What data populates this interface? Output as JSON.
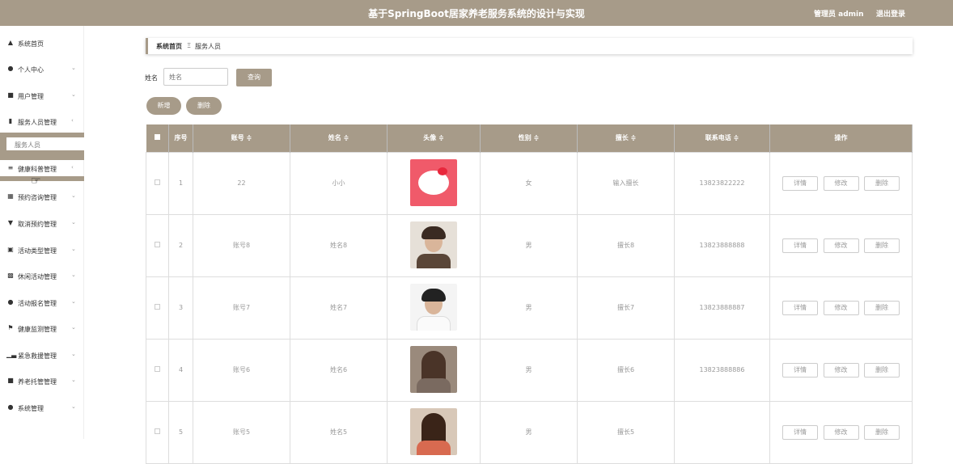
{
  "header": {
    "title": "基于SpringBoot居家养老服务系统的设计与实现",
    "admin_label": "管理员 admin",
    "logout_label": "退出登录"
  },
  "sidebar": {
    "items": [
      {
        "label": "系统首页",
        "icon": "home-icon"
      },
      {
        "label": "个人中心",
        "icon": "user-icon"
      },
      {
        "label": "用户管理",
        "icon": "grid-icon"
      },
      {
        "label": "服务人员管理",
        "icon": "id-card-icon"
      },
      {
        "label": "健康科普管理",
        "icon": "list-icon"
      },
      {
        "label": "预约咨询管理",
        "icon": "apps-icon"
      },
      {
        "label": "取消预约管理",
        "icon": "pin-icon"
      },
      {
        "label": "活动类型管理",
        "icon": "image-icon"
      },
      {
        "label": "休闲活动管理",
        "icon": "clipboard-icon"
      },
      {
        "label": "活动报名管理",
        "icon": "user-icon"
      },
      {
        "label": "健康监测管理",
        "icon": "flag-icon"
      },
      {
        "label": "紧急救援管理",
        "icon": "bar-chart-icon"
      },
      {
        "label": "养老托管管理",
        "icon": "grid-icon"
      },
      {
        "label": "系统管理",
        "icon": "user-icon"
      }
    ],
    "submenu_item": "服务人员"
  },
  "breadcrumb": {
    "home": "系统首页",
    "separator": "Ξ",
    "current": "服务人员"
  },
  "search": {
    "label": "姓名",
    "placeholder": "姓名",
    "query_button": "查询"
  },
  "actions": {
    "add_button": "新增",
    "delete_button": "删除"
  },
  "table": {
    "headers": [
      "序号",
      "账号 ≑",
      "姓名 ≑",
      "头像 ≑",
      "性别 ≑",
      "擅长 ≑",
      "联系电话 ≑",
      "操作"
    ],
    "rows": [
      {
        "index": "1",
        "account": "22",
        "name": "小小",
        "avatar": "hello-kitty",
        "gender": "女",
        "specialty": "输入擅长",
        "phone": "13823822222"
      },
      {
        "index": "2",
        "account": "账号8",
        "name": "姓名8",
        "avatar": "man-photo",
        "gender": "男",
        "specialty": "擅长8",
        "phone": "13823888888"
      },
      {
        "index": "3",
        "account": "账号7",
        "name": "姓名7",
        "avatar": "man-photo-2",
        "gender": "男",
        "specialty": "擅长7",
        "phone": "13823888887"
      },
      {
        "index": "4",
        "account": "账号6",
        "name": "姓名6",
        "avatar": "woman-photo",
        "gender": "男",
        "specialty": "擅长6",
        "phone": "13823888886"
      },
      {
        "index": "5",
        "account": "账号5",
        "name": "姓名5",
        "avatar": "woman-photo-2",
        "gender": "男",
        "specialty": "擅长5",
        "phone": ""
      }
    ],
    "row_actions": {
      "detail": "详情",
      "edit": "修改",
      "delete": "删除"
    }
  },
  "colors": {
    "accent": "#a79b89"
  }
}
